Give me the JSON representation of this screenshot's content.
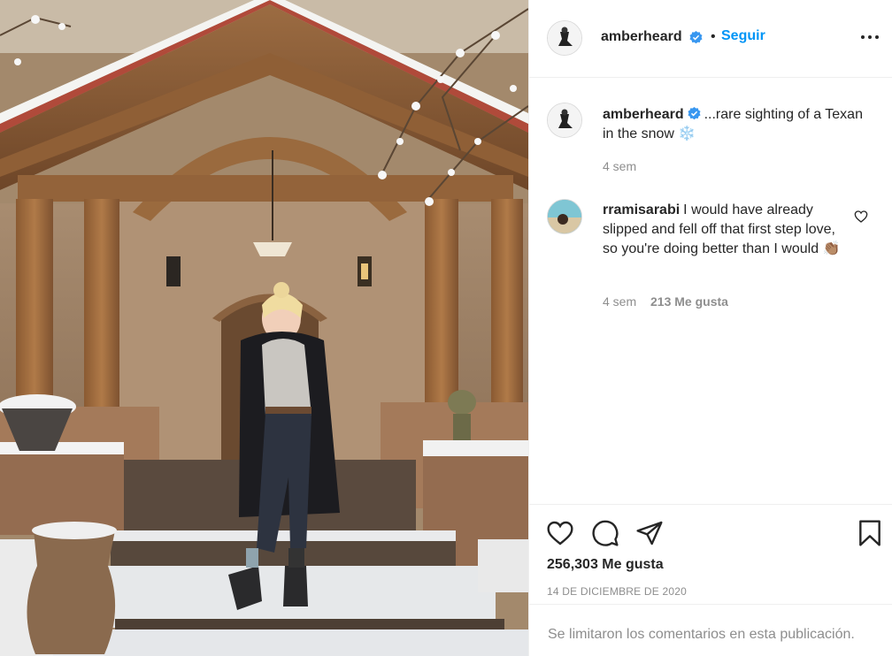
{
  "post": {
    "photo_icon": "post-photo-woman-in-snow"
  },
  "header": {
    "username": "amberheard",
    "verified_icon": "verified-badge-icon",
    "separator": "•",
    "follow_label": "Seguir",
    "more_icon": "more-options-icon"
  },
  "caption": {
    "username": "amberheard",
    "text": "...rare sighting of a Texan in the snow ❄️",
    "time": "4 sem"
  },
  "comment": {
    "username": "rramisarabi",
    "text": "I would have already slipped and fell off that first step love, so you're doing better than I would 👏🏽",
    "time": "4 sem",
    "likes": "213 Me gusta",
    "like_icon": "heart-outline-icon"
  },
  "actions": {
    "like_icon": "heart-icon",
    "comment_icon": "comment-icon",
    "share_icon": "paper-plane-icon",
    "save_icon": "bookmark-icon",
    "likes_count": "256,303 Me gusta",
    "date": "14 DE DICIEMBRE DE 2020"
  },
  "footer": {
    "comments_limited": "Se limitaron los comentarios en esta publicación."
  },
  "colors": {
    "link_blue": "#0095f6",
    "verified_blue": "#3897f0",
    "muted": "#8e8e8e",
    "text": "#262626",
    "border": "#efefef"
  }
}
